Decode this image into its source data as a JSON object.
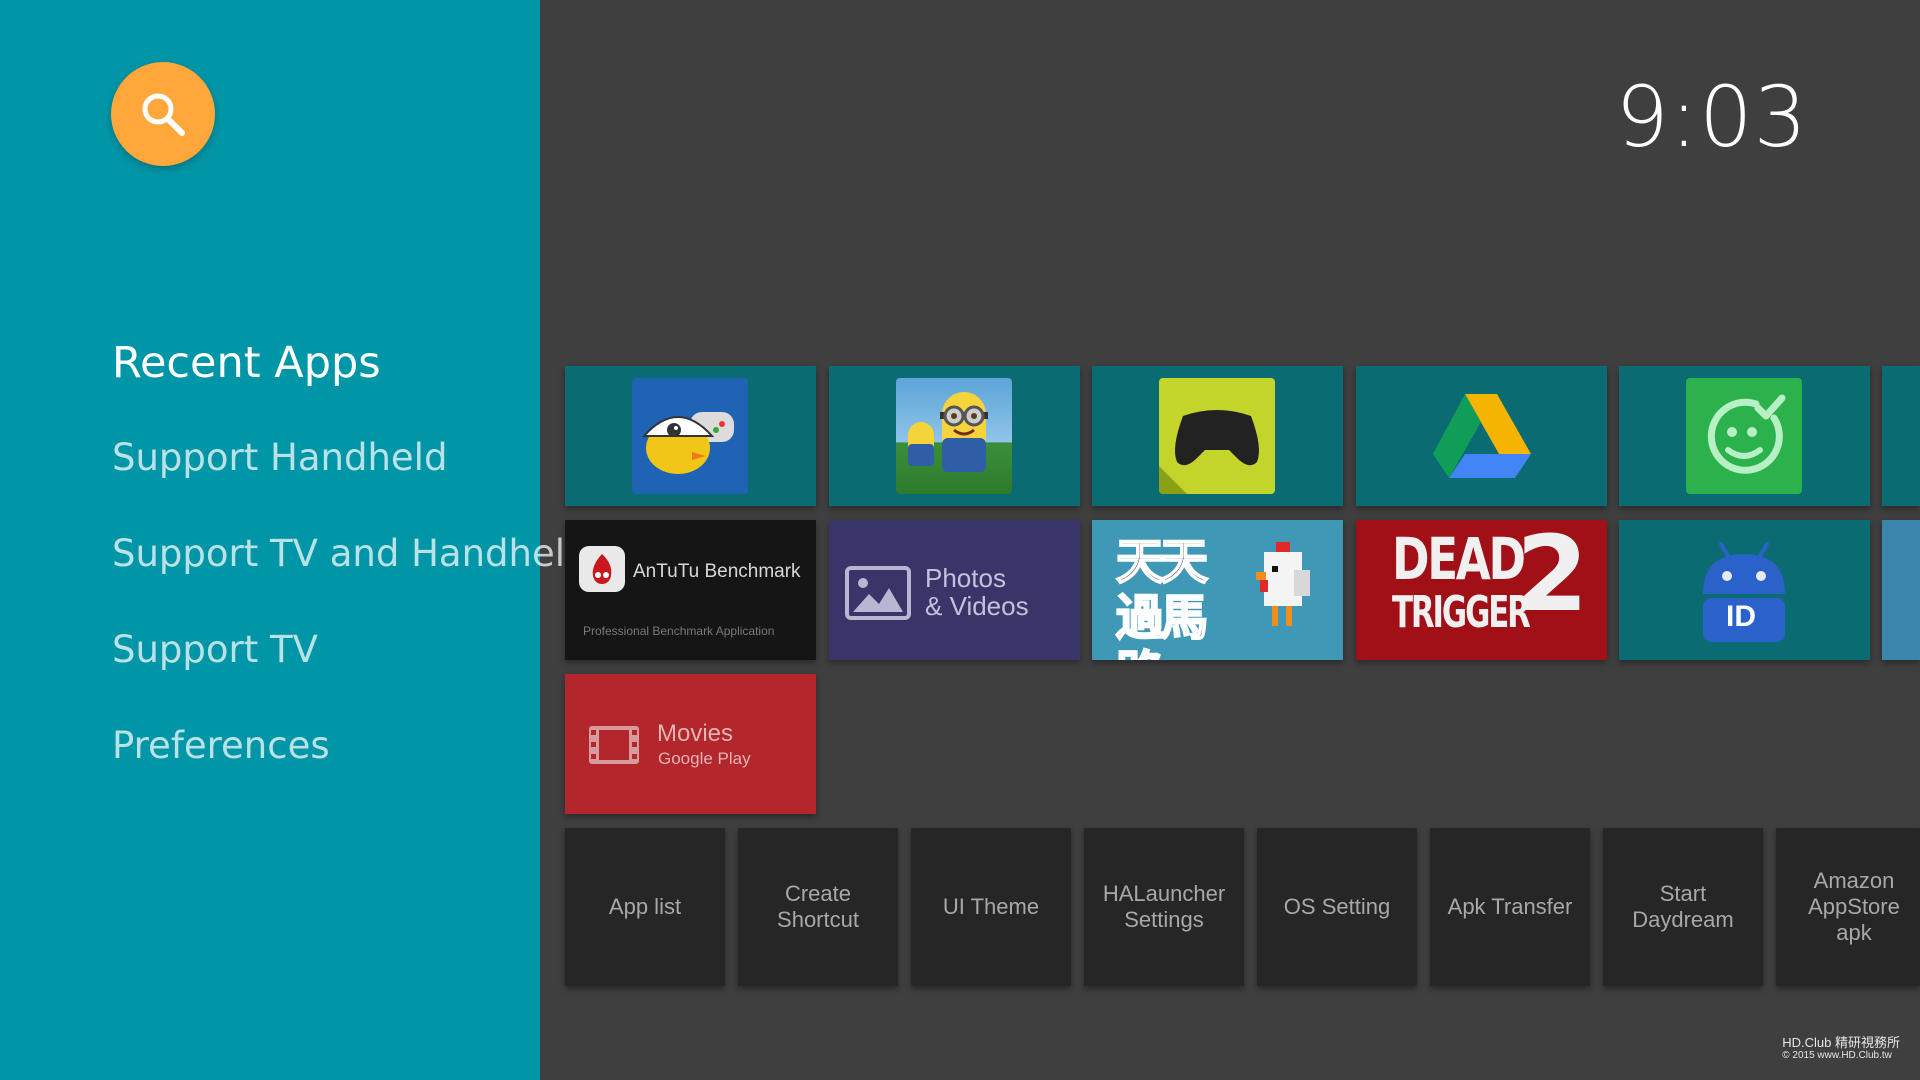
{
  "sidebar": {
    "search_icon": "search-icon",
    "items": [
      {
        "label": "Recent Apps",
        "active": true
      },
      {
        "label": "Support Handheld"
      },
      {
        "label": "Support TV and Handheld"
      },
      {
        "label": "Support TV"
      },
      {
        "label": "Preferences"
      }
    ]
  },
  "clock": "9:03",
  "tiles": {
    "antutu": {
      "title": "AnTuTu Benchmark",
      "subtitle": "Professional Benchmark Application"
    },
    "photos": {
      "line1": "Photos",
      "line2": "& Videos"
    },
    "crossy": {
      "text": "天天過馬路"
    },
    "dead_trigger": {
      "line1": "DEAD",
      "num": "2",
      "line2": "TRIGGER"
    },
    "app_id": {
      "text": "ID"
    },
    "movies": {
      "title": "Movies",
      "subtitle": "Google Play"
    }
  },
  "toolbar": [
    {
      "label": "App list"
    },
    {
      "label": "Create\nShortcut"
    },
    {
      "label": "UI Theme"
    },
    {
      "label": "HALauncher\nSettings"
    },
    {
      "label": "OS Setting"
    },
    {
      "label": "Apk Transfer"
    },
    {
      "label": "Start\nDaydream"
    },
    {
      "label": "Amazon\nAppStore apk"
    }
  ],
  "watermark": {
    "line1": "HD.Club 精研視務所",
    "line2": "© 2015  www.HD.Club.tw"
  },
  "colors": {
    "sidebar": "#0096a7",
    "search": "#ffa73a",
    "background": "#3f3f3f",
    "tile_teal": "#0a6b73",
    "tool_tile": "#262626"
  }
}
